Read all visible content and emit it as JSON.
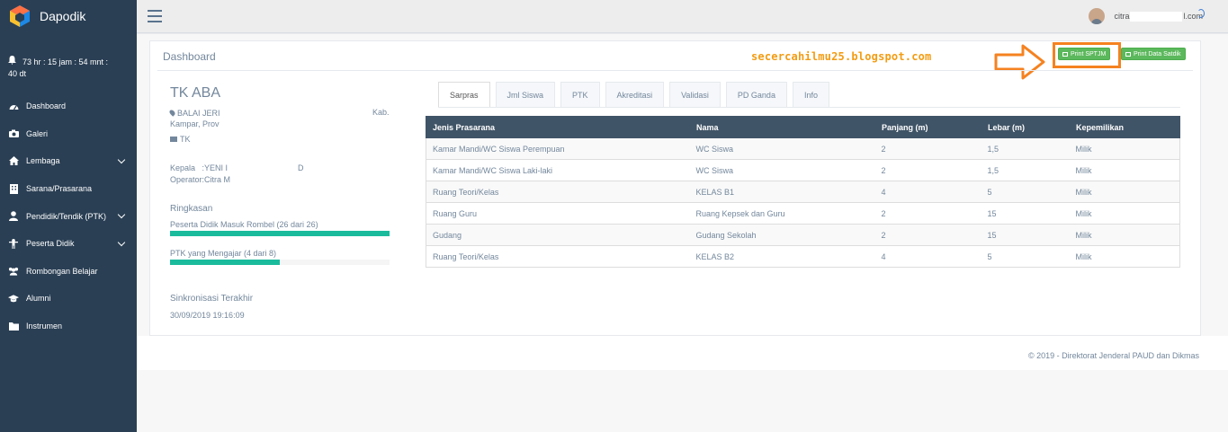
{
  "brand": {
    "name": "Dapodik"
  },
  "timer": {
    "line1": "73 hr : 15 jam : 54 mnt :",
    "line2": "40 dt"
  },
  "sidebar": {
    "items": [
      {
        "label": "Dashboard",
        "icon": "dashboard-icon",
        "has_children": false
      },
      {
        "label": "Galeri",
        "icon": "camera-icon",
        "has_children": false
      },
      {
        "label": "Lembaga",
        "icon": "home-icon",
        "has_children": true
      },
      {
        "label": "Sarana/Prasarana",
        "icon": "building-icon",
        "has_children": false
      },
      {
        "label": "Pendidik/Tendik (PTK)",
        "icon": "user-icon",
        "has_children": true
      },
      {
        "label": "Peserta Didik",
        "icon": "child-icon",
        "has_children": true
      },
      {
        "label": "Rombongan Belajar",
        "icon": "users-icon",
        "has_children": false
      },
      {
        "label": "Alumni",
        "icon": "graduation-cap-icon",
        "has_children": false
      },
      {
        "label": "Instrumen",
        "icon": "folder-icon",
        "has_children": false
      }
    ]
  },
  "topbar": {
    "user_prefix": "citra",
    "user_suffix": "l.com"
  },
  "panel": {
    "title": "Dashboard",
    "watermark": "secercahilmu25.blogspot.com",
    "btn_print_sptjm": "Print SPTJM",
    "btn_print_satdik": "Print Data Satdik"
  },
  "school": {
    "name": "TK ABA",
    "address_line1": "BALAI JERI",
    "address_kab": "Kab.",
    "address_line2": "Kampar, Prov",
    "jenjang": "TK",
    "kepala_label": "Kepala",
    "kepala_value": ":YENI I",
    "kepala_tail": "D",
    "operator_label": "Operator:",
    "operator_value": "Citra M"
  },
  "ringkasan": {
    "title": "Ringkasan",
    "items": [
      {
        "label": "Peserta Didik Masuk Rombel (26 dari 26)",
        "fraction": 1.0
      },
      {
        "label": "PTK yang Mengajar (4 dari 8)",
        "fraction": 0.5
      }
    ]
  },
  "sync": {
    "title": "Sinkronisasi Terakhir",
    "date": "30/09/2019 19:16:09"
  },
  "tabs": [
    {
      "label": "Sarpras",
      "active": true
    },
    {
      "label": "Jml Siswa",
      "active": false
    },
    {
      "label": "PTK",
      "active": false
    },
    {
      "label": "Akreditasi",
      "active": false
    },
    {
      "label": "Validasi",
      "active": false
    },
    {
      "label": "PD Ganda",
      "active": false
    },
    {
      "label": "Info",
      "active": false
    }
  ],
  "table": {
    "headers": [
      "Jenis Prasarana",
      "Nama",
      "Panjang (m)",
      "Lebar (m)",
      "Kepemilikan"
    ],
    "rows": [
      [
        "Kamar Mandi/WC Siswa Perempuan",
        "WC Siswa",
        "2",
        "1,5",
        "Milik"
      ],
      [
        "Kamar Mandi/WC Siswa Laki-laki",
        "WC Siswa",
        "2",
        "1,5",
        "Milik"
      ],
      [
        "Ruang Teori/Kelas",
        "KELAS B1",
        "4",
        "5",
        "Milik"
      ],
      [
        "Ruang Guru",
        "Ruang Kepsek dan Guru",
        "2",
        "15",
        "Milik"
      ],
      [
        "Gudang",
        "Gudang Sekolah",
        "2",
        "15",
        "Milik"
      ],
      [
        "Ruang Teori/Kelas",
        "KELAS B2",
        "4",
        "5",
        "Milik"
      ]
    ]
  },
  "footer": {
    "text": "©   2019 - Direktorat Jenderal PAUD dan Dikmas"
  },
  "colors": {
    "sidebar": "#2a3f54",
    "accent": "#1abb9c",
    "button": "#5cb85c",
    "highlight": "#f58220",
    "table_header": "#405467"
  }
}
